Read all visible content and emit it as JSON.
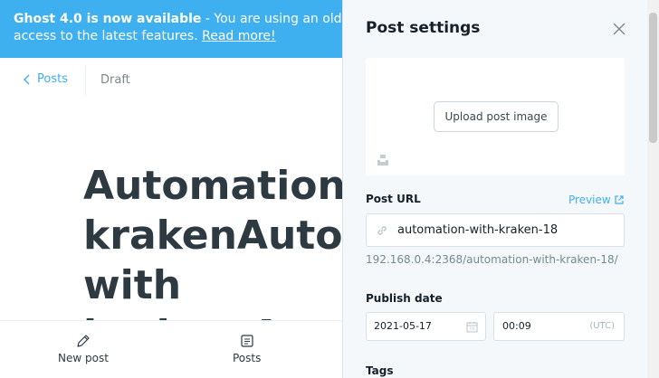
{
  "banner": {
    "bold": "Ghost 4.0 is now available",
    "text_line1": " - You are using an old version",
    "text_line2": "access to the latest features. ",
    "link": "Read more!"
  },
  "nav": {
    "back_label": "Posts",
    "status": "Draft"
  },
  "editor": {
    "title_lines": [
      "Automation w",
      "krakenAutom",
      "with",
      "kraken Auto"
    ]
  },
  "bottom_bar": {
    "new_post": "New post",
    "posts": "Posts"
  },
  "settings": {
    "title": "Post settings",
    "upload_button": "Upload post image",
    "post_url_label": "Post URL",
    "preview_label": "Preview",
    "url_value": "automation-with-kraken-18",
    "url_hint": "192.168.0.4:2368/automation-with-kraken-18/",
    "publish_date_label": "Publish date",
    "date_value": "2021-05-17",
    "time_value": "00:09",
    "timezone": "(UTC)",
    "tags_label": "Tags"
  },
  "colors": {
    "accent": "#3eb0ef",
    "panel_bg": "#f4f8fb",
    "text": "#15212a"
  },
  "icons": [
    "chevron-left-icon",
    "pencil-icon",
    "posts-icon",
    "close-icon",
    "unsplash-icon",
    "link-icon",
    "external-link-icon",
    "calendar-icon"
  ]
}
